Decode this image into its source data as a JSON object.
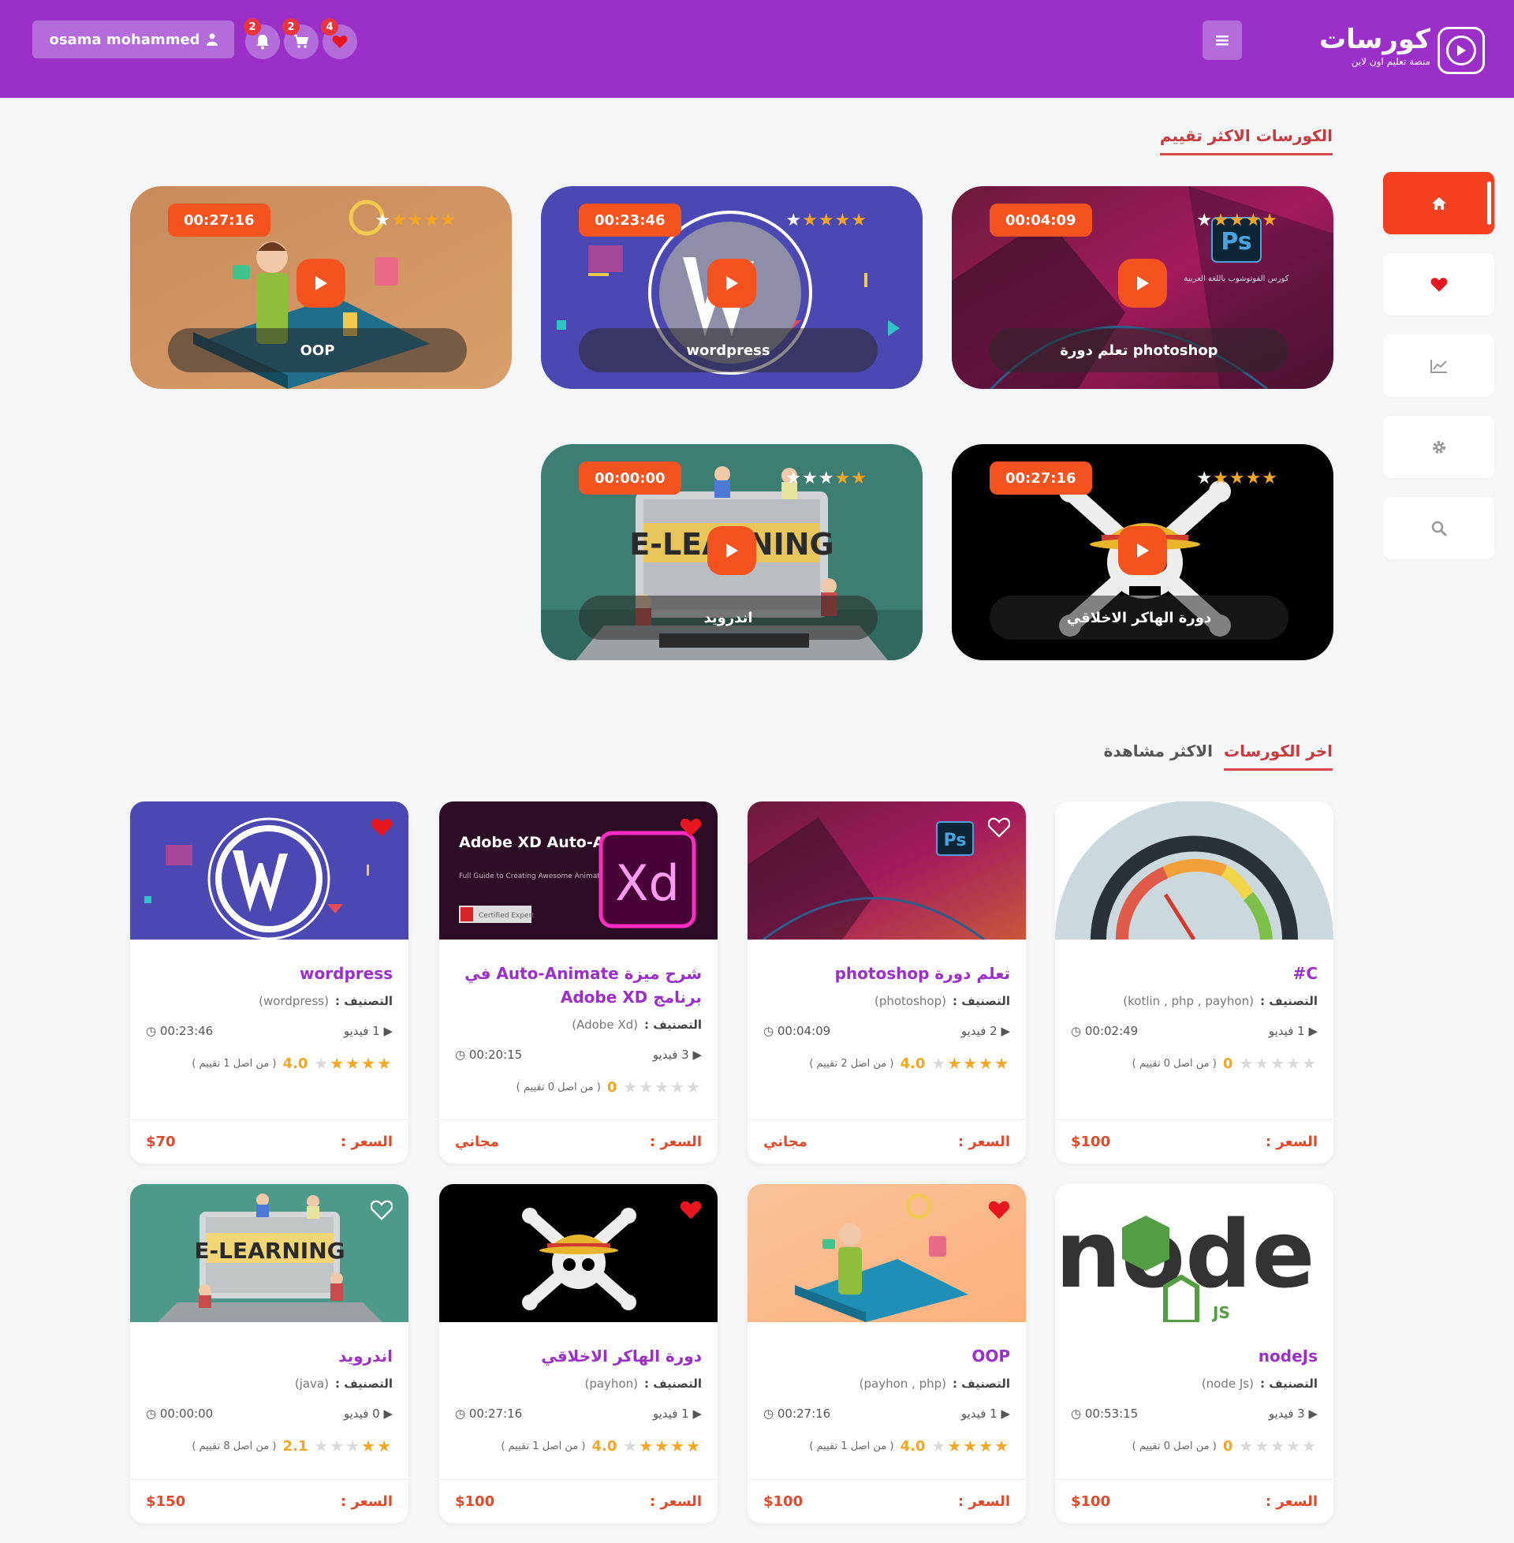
{
  "header": {
    "username": "osama mohammed",
    "notifications_count": "2",
    "cart_count": "2",
    "favorites_count": "4",
    "logo_title": "كورسات",
    "logo_subtitle": "منصة تعليم اون لاين",
    "bg_color": "#9b30c9"
  },
  "sidebar": {
    "items": [
      {
        "icon": "home-icon",
        "active": true
      },
      {
        "icon": "heart-icon",
        "active": false
      },
      {
        "icon": "chart-icon",
        "active": false
      },
      {
        "icon": "gear-icon",
        "active": false
      },
      {
        "icon": "search-icon",
        "active": false
      }
    ]
  },
  "top_rated": {
    "title": "الكورسات الاكثر تقييم",
    "courses": [
      {
        "title": "تعلم دورة photoshop",
        "duration": "00:04:09",
        "stars": 5
      },
      {
        "title": "wordpress",
        "duration": "00:23:46",
        "stars": 4
      },
      {
        "title": "OOP",
        "duration": "00:27:16",
        "stars": 4
      },
      {
        "title": "دورة الهاكر الاخلاقي",
        "duration": "00:27:16",
        "stars": 4
      },
      {
        "title": "اندرويد",
        "duration": "00:00:00",
        "stars": 2
      }
    ]
  },
  "tabs": {
    "latest": "اخر الكورسات",
    "most_viewed": "الاكثر مشاهدة"
  },
  "labels": {
    "category": "التصنيف :",
    "price": "السعر :",
    "videos_suffix": "فيديو"
  },
  "courses": [
    {
      "title": "C#",
      "category": "(kotlin , php , payhon)",
      "videos": "1 فيديو",
      "duration": "00:02:49",
      "rating": "0",
      "rating_text": "( من اصل 0 تقييم )",
      "stars": 0,
      "price": "$100",
      "favorite": false
    },
    {
      "title": "تعلم دورة photoshop",
      "category": "(photoshop)",
      "videos": "2 فيديو",
      "duration": "00:04:09",
      "rating": "4.0",
      "rating_text": "( من اصل 2 تقييم )",
      "stars": 4,
      "price": "مجاني",
      "favorite": false
    },
    {
      "title": "شرح ميزة Auto-Animate في برنامج Adobe XD",
      "category": "(Adobe Xd)",
      "videos": "3 فيديو",
      "duration": "00:20:15",
      "rating": "0",
      "rating_text": "( من اصل 0 تقييم )",
      "stars": 0,
      "price": "مجاني",
      "favorite": true
    },
    {
      "title": "wordpress",
      "category": "(wordpress)",
      "videos": "1 فيديو",
      "duration": "00:23:46",
      "rating": "4.0",
      "rating_text": "( من اصل 1 تقييم )",
      "stars": 4,
      "price": "$70",
      "favorite": true
    },
    {
      "title": "nodeJs",
      "category": "(node Js)",
      "videos": "3 فيديو",
      "duration": "00:53:15",
      "rating": "0",
      "rating_text": "( من اصل 0 تقييم )",
      "stars": 0,
      "price": "$100",
      "favorite": false
    },
    {
      "title": "OOP",
      "category": "(payhon , php)",
      "videos": "1 فيديو",
      "duration": "00:27:16",
      "rating": "4.0",
      "rating_text": "( من اصل 1 تقييم )",
      "stars": 4,
      "price": "$100",
      "favorite": true
    },
    {
      "title": "دورة الهاكر الاخلاقي",
      "category": "(payhon)",
      "videos": "1 فيديو",
      "duration": "00:27:16",
      "rating": "4.0",
      "rating_text": "( من اصل 1 تقييم )",
      "stars": 4,
      "price": "$100",
      "favorite": true
    },
    {
      "title": "اندرويد",
      "category": "(java)",
      "videos": "0 فيديو",
      "duration": "00:00:00",
      "rating": "2.1",
      "rating_text": "( من اصل 8 تقييم )",
      "stars": 2,
      "price": "$150",
      "favorite": false
    }
  ],
  "thumb_text": {
    "xd_title": "Adobe XD Auto-Animate",
    "xd_sub": "Full Guide to Creating Awesome Animations",
    "xd_badge": "Certified Expert",
    "xd_logo": "Xd",
    "ps_logo": "Ps",
    "ps_sub": "كورس الفوتوشوب باللغة العربية",
    "elearning": "E-LEARNING",
    "node_logo": "node",
    "node_js": "JS"
  }
}
